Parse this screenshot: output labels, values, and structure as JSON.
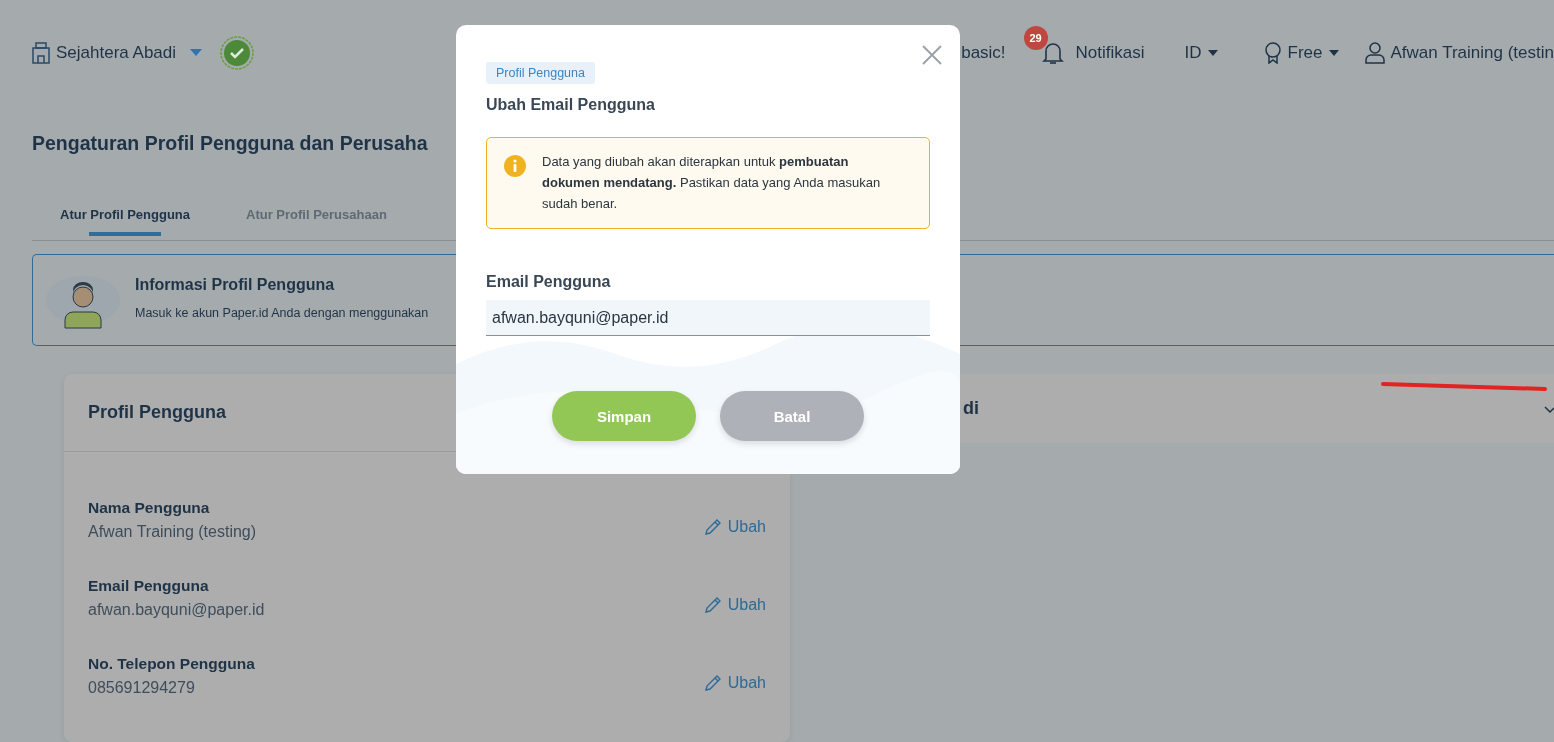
{
  "header": {
    "company": "Sejahtera Abadi",
    "verified": true,
    "promo": "basic!",
    "notifications": {
      "badge": "29",
      "label": "Notifikasi"
    },
    "language": "ID",
    "plan": "Free",
    "user": "Afwan Training (testin"
  },
  "page_title": "Pengaturan Profil Pengguna dan Perusaha",
  "tabs": [
    {
      "label": "Atur Profil Pengguna",
      "selected": true
    },
    {
      "label": "Atur Profil Perusahaan",
      "selected": false
    }
  ],
  "info_banner": {
    "title": "Informasi Profil Pengguna",
    "text": "Masuk ke akun Paper.id Anda dengan menggunakan"
  },
  "profile_card": {
    "title": "Profil Pengguna",
    "fields": [
      {
        "label": "Nama Pengguna",
        "value": "Afwan Training (testing)",
        "action": "Ubah"
      },
      {
        "label": "Email Pengguna",
        "value": "afwan.bayquni@paper.id",
        "action": "Ubah"
      },
      {
        "label": "No. Telepon Pengguna",
        "value": "085691294279",
        "action": "Ubah"
      }
    ]
  },
  "company_card": {
    "title": "di"
  },
  "modal": {
    "tag": "Profil Pengguna",
    "title": "Ubah Email Pengguna",
    "notice": "Data yang diubah akan diterapkan untuk **pembuatan dokumen mendatang.** Pastikan data yang Anda masukan sudah benar.",
    "field_label": "Email Pengguna",
    "field_value": "afwan.bayquni@paper.id",
    "buttons": [
      {
        "label": "Simpan",
        "kind": "primary"
      },
      {
        "label": "Batal",
        "kind": "secondary"
      }
    ]
  }
}
